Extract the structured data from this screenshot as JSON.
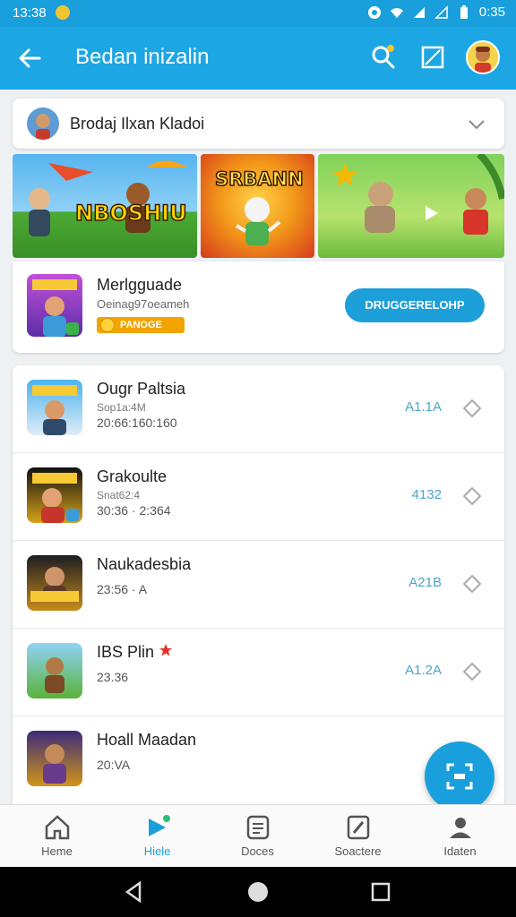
{
  "status_bar": {
    "time_left": "13:38",
    "time_right": "0:35"
  },
  "app_bar": {
    "title": "Bedan inizalin"
  },
  "selector": {
    "label": "Brodaj Ilxan Kladoi"
  },
  "banners": [
    {
      "text": "NBOSHIU"
    },
    {
      "text": "SRBANN"
    },
    {
      "text": ""
    }
  ],
  "featured": {
    "name": "Merlgguade",
    "subtitle": "Oeinag97oeameh",
    "tag": "PANOGE",
    "button": "DRUGGERELOHP"
  },
  "list": [
    {
      "name": "Ougr Paltsia",
      "sub1": "Sop1a:4M",
      "sub2": "20:66:160:160",
      "score": "A1.1A"
    },
    {
      "name": "Grakoulte",
      "sub1": "Snat62:4",
      "sub2": "30:36 · 2:364",
      "score": "4132"
    },
    {
      "name": "Naukadesbia",
      "sub1": "",
      "sub2": "23:56 · A",
      "score": "A21B"
    },
    {
      "name": "IBS Plin",
      "sub1": "",
      "sub2": "23.36",
      "score": "A1.2A"
    },
    {
      "name": "Hoall Maadan",
      "sub1": "",
      "sub2": "20:VA",
      "score": ""
    }
  ],
  "bottom_nav": [
    {
      "label": "Heme",
      "active": false
    },
    {
      "label": "Hiele",
      "active": true
    },
    {
      "label": "Doces",
      "active": false
    },
    {
      "label": "Soactere",
      "active": false
    },
    {
      "label": "Idaten",
      "active": false
    }
  ],
  "colors": {
    "primary": "#1da6e4",
    "accent_score": "#4aa6c9",
    "background": "#eef1f4"
  },
  "icons": [
    "back-arrow-icon",
    "search-icon",
    "image-icon",
    "chevron-down-icon",
    "diamond-icon",
    "scan-icon",
    "home-icon",
    "play-icon",
    "document-icon",
    "edit-icon",
    "profile-icon"
  ]
}
